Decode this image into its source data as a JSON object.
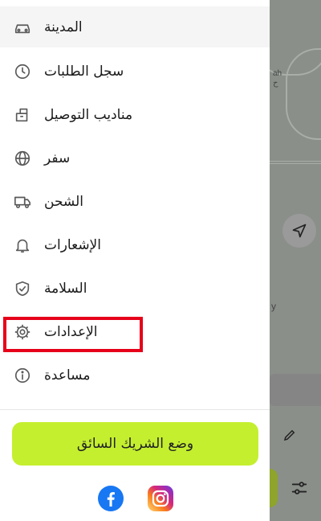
{
  "menu": {
    "items": [
      {
        "label": "المدينة",
        "icon": "car-icon"
      },
      {
        "label": "سجل الطلبات",
        "icon": "clock-icon"
      },
      {
        "label": "مناديب التوصيل",
        "icon": "package-icon"
      },
      {
        "label": "سفر",
        "icon": "globe-icon"
      },
      {
        "label": "الشحن",
        "icon": "truck-icon"
      },
      {
        "label": "الإشعارات",
        "icon": "bell-icon"
      },
      {
        "label": "السلامة",
        "icon": "shield-check-icon"
      },
      {
        "label": "الإعدادات",
        "icon": "gear-icon"
      },
      {
        "label": "مساعدة",
        "icon": "info-icon"
      }
    ]
  },
  "driver_button": {
    "label": "وضع الشريك السائق"
  },
  "social": {
    "facebook_icon": "facebook-icon",
    "instagram_icon": "instagram-icon"
  },
  "map": {
    "place_label": "ah",
    "place_label_ar": "ح",
    "partial_text": "y"
  },
  "colors": {
    "accent": "#c4ef2f",
    "highlight": "#e6001a",
    "icon": "#5a5a5a"
  }
}
